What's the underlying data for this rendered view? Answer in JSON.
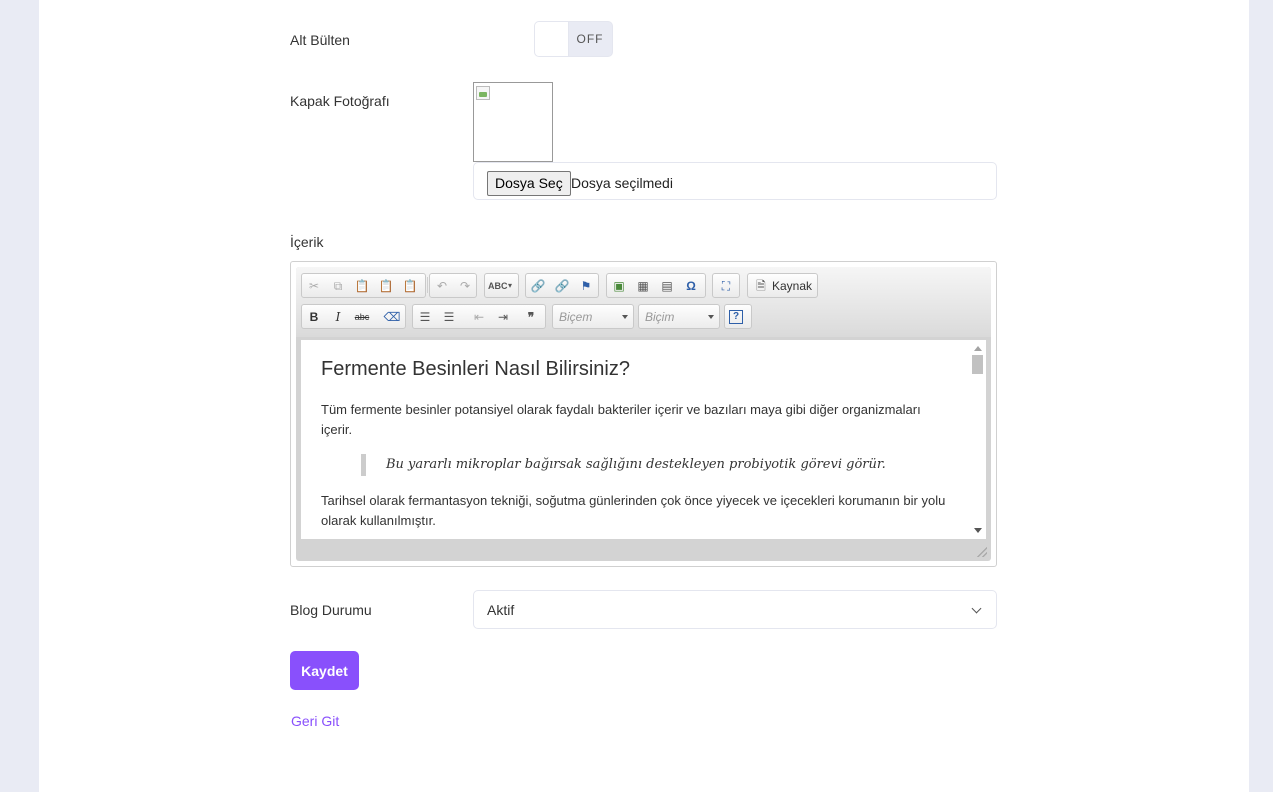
{
  "form": {
    "newsletter_label": "Alt Bülten",
    "newsletter_state": "OFF",
    "cover_label": "Kapak Fotoğrafı",
    "file_button": "Dosya Seç",
    "file_status": "Dosya seçilmedi",
    "content_label": "İçerik",
    "status_label": "Blog Durumu",
    "status_value": "Aktif",
    "save_button": "Kaydet",
    "back_link": "Geri Git"
  },
  "editor": {
    "source_button": "Kaynak",
    "format_combo_1": "Biçem",
    "format_combo_2": "Biçim",
    "icons_row1": [
      "cut-icon",
      "copy-icon",
      "paste-icon",
      "paste-text-icon",
      "paste-word-icon",
      "undo-icon",
      "redo-icon",
      "spellcheck-icon",
      "link-icon",
      "unlink-icon",
      "anchor-icon",
      "image-icon",
      "table-icon",
      "horizontal-rule-icon",
      "special-char-icon",
      "maximize-icon",
      "source-icon"
    ],
    "icons_row2": [
      "bold-icon",
      "italic-icon",
      "strike-icon",
      "remove-format-icon",
      "numbered-list-icon",
      "bullet-list-icon",
      "outdent-icon",
      "indent-icon",
      "blockquote-icon",
      "help-icon"
    ],
    "content": {
      "heading": "Fermente Besinleri Nasıl Bilirsiniz?",
      "paragraph1": "Tüm fermente besinler potansiyel olarak faydalı bakteriler içerir ve bazıları maya gibi diğer organizmaları içerir.",
      "quote": "Bu yararlı mikroplar bağırsak sağlığını destekleyen probiyotik görevi görür.",
      "paragraph2": "Tarihsel olarak fermantasyon tekniği, soğutma günlerinden çok önce yiyecek ve içecekleri korumanın bir yolu olarak kullanılmıştır."
    }
  },
  "colors": {
    "accent": "#8950fc",
    "page_background": "#e9ebf4"
  }
}
